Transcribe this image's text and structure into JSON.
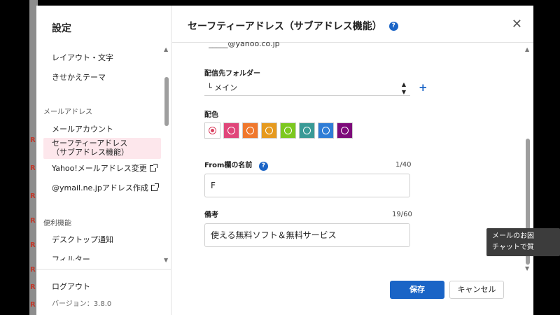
{
  "sidebar": {
    "title": "設定",
    "items": [
      {
        "label": "レイアウト・文字"
      },
      {
        "label": "きせかえテーマ"
      },
      {
        "label": "メールアカウント"
      },
      {
        "label_line1": "セーフティーアドレス",
        "label_line2": "（サブアドレス機能）"
      },
      {
        "label": "Yahoo!メールアドレス変更"
      },
      {
        "label": "@ymail.ne.jpアドレス作成"
      },
      {
        "label": "デスクトップ通知"
      },
      {
        "label": "フィルター"
      }
    ],
    "sections": {
      "mail_address": "メールアドレス",
      "useful": "便利機能"
    },
    "footer": {
      "logout": "ログアウト",
      "version": "バージョン：3.8.0"
    }
  },
  "main": {
    "title": "セーフティーアドレス（サブアドレス機能）",
    "email_partial": "_____@yahoo.co.jp",
    "folder": {
      "label": "配信先フォルダー",
      "value": "└ メイン"
    },
    "color": {
      "label": "配色",
      "swatches": [
        "#ffffff",
        "#e0467a",
        "#f0782d",
        "#e69a1e",
        "#7cc81f",
        "#3a9a96",
        "#2f7dd6",
        "#7d0a7a"
      ]
    },
    "from_name": {
      "label": "From欄の名前",
      "count": "1/40",
      "value": "F"
    },
    "note": {
      "label": "備考",
      "count": "19/60",
      "value": "使える無料ソフト＆無料サービス"
    },
    "buttons": {
      "save": "保存",
      "cancel": "キャンセル"
    }
  },
  "tooltip": {
    "line1": "メールのお困",
    "line2": "チャットで質"
  },
  "backdrop_marks": [
    "R",
    "R",
    "R",
    "R",
    "R",
    "R",
    "R",
    "R"
  ]
}
